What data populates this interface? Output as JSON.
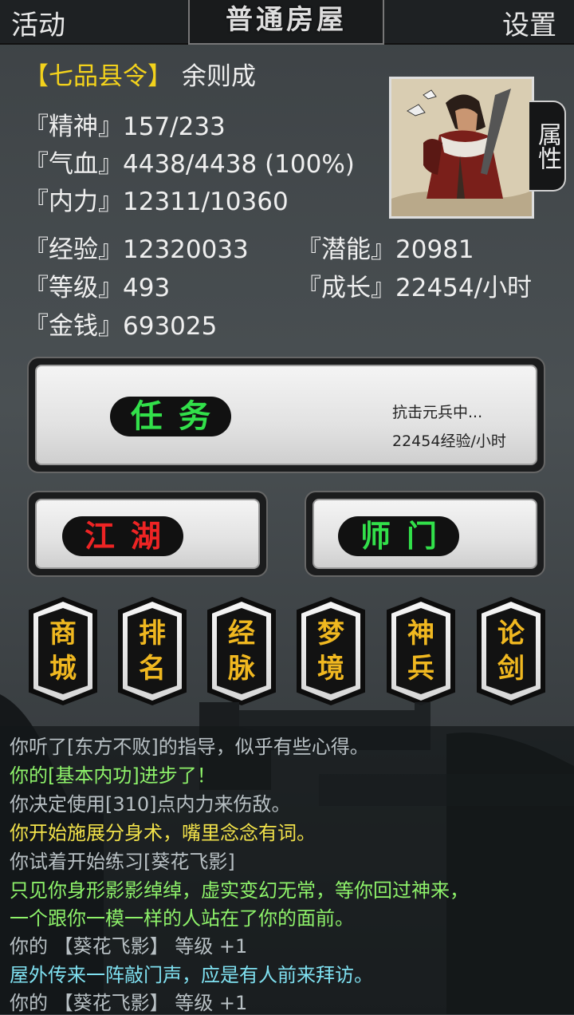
{
  "header": {
    "left": "活动",
    "title": "普通房屋",
    "right": "设置"
  },
  "player": {
    "rank": "【七品县令】",
    "name": "余则成",
    "spirit": "『精神』157/233",
    "hp": "『气血』4438/4438 (100%)",
    "inner": "『内力』12311/10360",
    "exp": "『经验』12320033",
    "potential": "『潜能』20981",
    "level": "『等级』493",
    "growth": "『成长』22454/小时",
    "money": "『金钱』693025"
  },
  "portrait_tab": "属性",
  "task": {
    "label": "任务",
    "status": "抗击元兵中...",
    "rate": "22454经验/小时"
  },
  "buttons": {
    "jianghu": "江湖",
    "shimen": "师门"
  },
  "hex_buttons": [
    {
      "top": "商",
      "bottom": "城"
    },
    {
      "top": "排",
      "bottom": "名"
    },
    {
      "top": "经",
      "bottom": "脉"
    },
    {
      "top": "梦",
      "bottom": "境"
    },
    {
      "top": "神",
      "bottom": "兵"
    },
    {
      "top": "论",
      "bottom": "剑"
    }
  ],
  "log": [
    {
      "text": "你听了[东方不败]的指导，似乎有些心得。",
      "color": "#b8c0c4"
    },
    {
      "text": "你的[基本内功]进步了！",
      "color": "#8ef26a"
    },
    {
      "text": "你决定使用[310]点内力来伤敌。",
      "color": "#b8c0c4"
    },
    {
      "text": "你开始施展分身术，嘴里念念有词。",
      "color": "#f2e24a"
    },
    {
      "text": "你试着开始练习[葵花飞影]",
      "color": "#b8c0c4"
    },
    {
      "text": "只见你身形影影绰绰，虚实变幻无常，等你回过神来，",
      "color": "#8ef26a"
    },
    {
      "text": "一个跟你一模一样的人站在了你的面前。",
      "color": "#8ef26a"
    },
    {
      "text": "你的 【葵花飞影】 等级 +1",
      "color": "#b8c0c4"
    },
    {
      "text": "屋外传来一阵敲门声，应是有人前来拜访。",
      "color": "#7fe0f0"
    },
    {
      "text": "你的 【葵花飞影】 等级 +1",
      "color": "#b8c0c4"
    }
  ],
  "colors": {
    "task": "#32e04a",
    "jianghu": "#ee2424",
    "shimen": "#32e04a",
    "hex_text": "#f0b820"
  }
}
